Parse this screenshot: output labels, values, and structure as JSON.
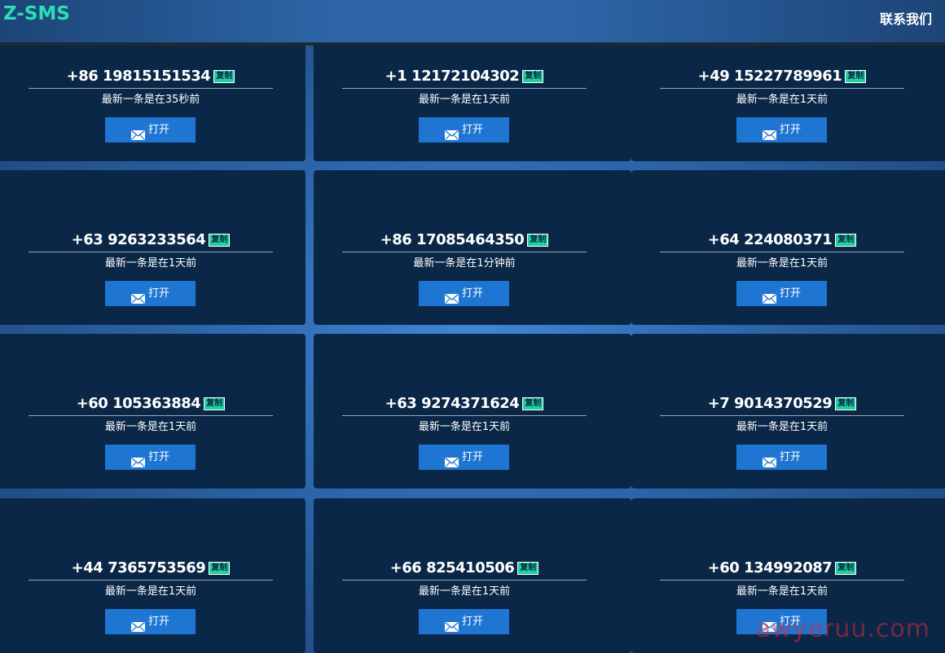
{
  "header": {
    "logo": "Z-SMS",
    "contact": "联系我们"
  },
  "cards": [
    {
      "number": "+86 19815151534",
      "copy": "复制",
      "status": "最新一条是在35秒前",
      "button": "打开"
    },
    {
      "number": "+1 12172104302",
      "copy": "复制",
      "status": "最新一条是在1天前",
      "button": "打开"
    },
    {
      "number": "+49 15227789961",
      "copy": "复制",
      "status": "最新一条是在1天前",
      "button": "打开"
    },
    {
      "number": "+63 9263233564",
      "copy": "复制",
      "status": "最新一条是在1天前",
      "button": "打开"
    },
    {
      "number": "+86 17085464350",
      "copy": "复制",
      "status": "最新一条是在1分钟前",
      "button": "打开"
    },
    {
      "number": "+64 224080371",
      "copy": "复制",
      "status": "最新一条是在1天前",
      "button": "打开"
    },
    {
      "number": "+60 105363884",
      "copy": "复制",
      "status": "最新一条是在1天前",
      "button": "打开"
    },
    {
      "number": "+63 9274371624",
      "copy": "复制",
      "status": "最新一条是在1天前",
      "button": "打开"
    },
    {
      "number": "+7 9014370529",
      "copy": "复制",
      "status": "最新一条是在1天前",
      "button": "打开"
    },
    {
      "number": "+44 7365753569",
      "copy": "复制",
      "status": "最新一条是在1天前",
      "button": "打开"
    },
    {
      "number": "+66 825410506",
      "copy": "复制",
      "status": "最新一条是在1天前",
      "button": "打开"
    },
    {
      "number": "+60 134992087",
      "copy": "复制",
      "status": "最新一条是在1天前",
      "button": "打开"
    }
  ],
  "watermark": "awyeruu.com",
  "icons": {
    "open": "mail-icon"
  },
  "colors": {
    "logo": "#28e0b4",
    "card_bg": "#0a2747",
    "button": "#1f76d2",
    "copy_badge": "#1fd19e"
  }
}
